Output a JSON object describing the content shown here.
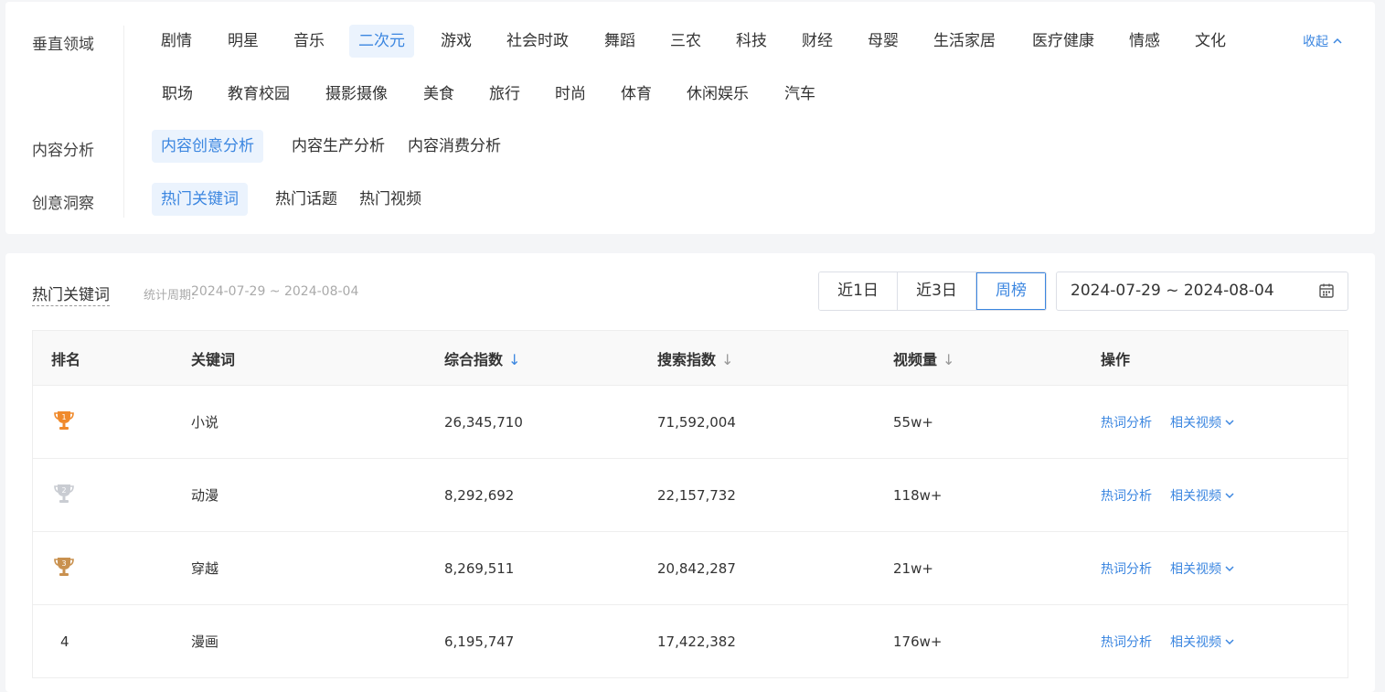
{
  "filters": {
    "vertical_label": "垂直领域",
    "vertical_row1": [
      "剧情",
      "明星",
      "音乐",
      "二次元",
      "游戏",
      "社会时政",
      "舞蹈",
      "三农",
      "科技",
      "财经",
      "母婴",
      "生活家居",
      "医疗健康",
      "情感",
      "文化"
    ],
    "vertical_row2": [
      "职场",
      "教育校园",
      "摄影摄像",
      "美食",
      "旅行",
      "时尚",
      "体育",
      "休闲娱乐",
      "汽车"
    ],
    "vertical_active": "二次元",
    "collapse_label": "收起",
    "content_label": "内容分析",
    "content_items": [
      "内容创意分析",
      "内容生产分析",
      "内容消费分析"
    ],
    "content_active": "内容创意分析",
    "insight_label": "创意洞察",
    "insight_items": [
      "热门关键词",
      "热门话题",
      "热门视频"
    ],
    "insight_active": "热门关键词"
  },
  "list": {
    "title": "热门关键词",
    "period_label": "统计周期:",
    "period_value": "2024-07-29 ~ 2024-08-04",
    "tabs": [
      "近1日",
      "近3日",
      "周榜"
    ],
    "active_tab": "周榜",
    "date_range": "2024-07-29 ~ 2024-08-04",
    "columns": {
      "rank": "排名",
      "keyword": "关键词",
      "composite": "综合指数",
      "search": "搜索指数",
      "videos": "视频量",
      "ops": "操作"
    },
    "op_labels": {
      "analysis": "热词分析",
      "related": "相关视频"
    },
    "rows": [
      {
        "rank": "1",
        "keyword": "小说",
        "composite": "26,345,710",
        "search": "71,592,004",
        "videos": "55w+",
        "medal": "gold"
      },
      {
        "rank": "2",
        "keyword": "动漫",
        "composite": "8,292,692",
        "search": "22,157,732",
        "videos": "118w+",
        "medal": "silver"
      },
      {
        "rank": "3",
        "keyword": "穿越",
        "composite": "8,269,511",
        "search": "20,842,287",
        "videos": "21w+",
        "medal": "bronze"
      },
      {
        "rank": "4",
        "keyword": "漫画",
        "composite": "6,195,747",
        "search": "17,422,382",
        "videos": "176w+",
        "medal": "none"
      }
    ]
  },
  "colors": {
    "accent": "#3b86e0",
    "gold": "#f08a2c",
    "silver": "#c9ccd2",
    "bronze": "#c9914f"
  }
}
